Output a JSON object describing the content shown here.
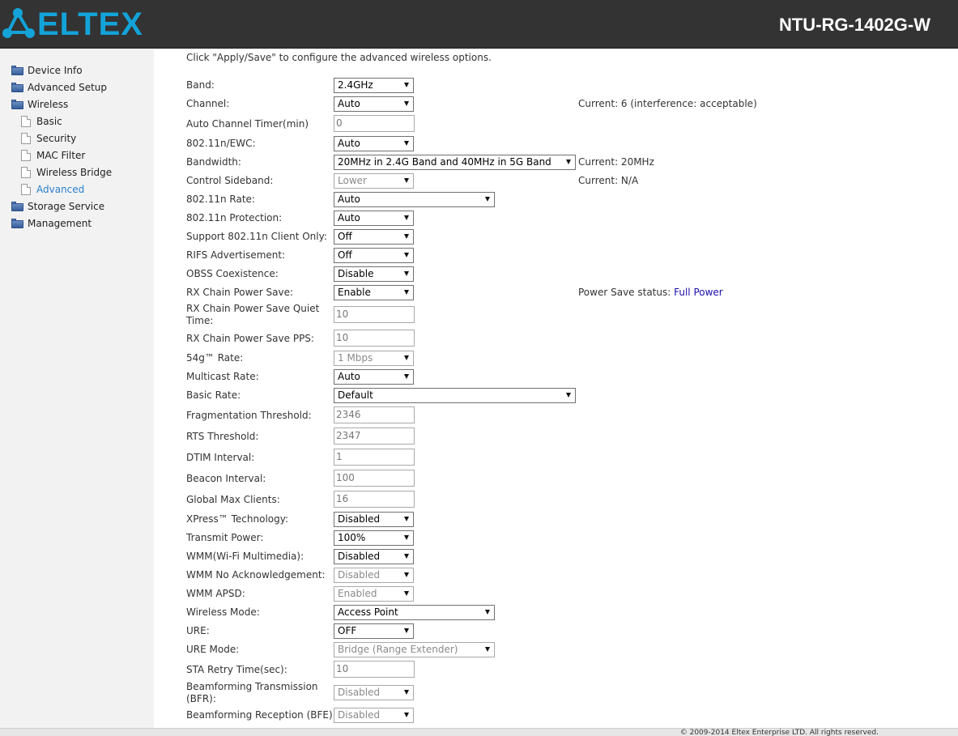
{
  "header": {
    "logo_text": "ELTEX",
    "model": "NTU-RG-1402G-W"
  },
  "sidebar": {
    "items": [
      {
        "label": "Device Info",
        "type": "folder"
      },
      {
        "label": "Advanced Setup",
        "type": "folder"
      },
      {
        "label": "Wireless",
        "type": "folder"
      },
      {
        "label": "Basic",
        "type": "doc"
      },
      {
        "label": "Security",
        "type": "doc"
      },
      {
        "label": "MAC Filter",
        "type": "doc"
      },
      {
        "label": "Wireless Bridge",
        "type": "doc"
      },
      {
        "label": "Advanced",
        "type": "doc",
        "active": true
      },
      {
        "label": "Storage Service",
        "type": "folder"
      },
      {
        "label": "Management",
        "type": "folder"
      }
    ]
  },
  "main": {
    "intro": "Click \"Apply/Save\" to configure the advanced wireless options.",
    "fields": {
      "band": {
        "label": "Band:",
        "value": "2.4GHz"
      },
      "channel": {
        "label": "Channel:",
        "value": "Auto",
        "status": "Current: 6 (interference: acceptable)"
      },
      "auto_channel_timer": {
        "label": "Auto Channel Timer(min)",
        "value": "0"
      },
      "ewc": {
        "label": "802.11n/EWC:",
        "value": "Auto"
      },
      "bandwidth": {
        "label": "Bandwidth:",
        "value": "20MHz in 2.4G Band and 40MHz in 5G Band",
        "status": "Current: 20MHz"
      },
      "control_sideband": {
        "label": "Control Sideband:",
        "value": "Lower",
        "status": "Current: N/A"
      },
      "n_rate": {
        "label": "802.11n Rate:",
        "value": "Auto"
      },
      "n_protection": {
        "label": "802.11n Protection:",
        "value": "Auto"
      },
      "n_client_only": {
        "label": "Support 802.11n Client Only:",
        "value": "Off"
      },
      "rifs": {
        "label": "RIFS Advertisement:",
        "value": "Off"
      },
      "obss": {
        "label": "OBSS Coexistence:",
        "value": "Disable"
      },
      "rx_power_save": {
        "label": "RX Chain Power Save:",
        "value": "Enable",
        "status_prefix": "Power Save status: ",
        "status_value": "Full Power"
      },
      "rx_quiet_time": {
        "label": "RX Chain Power Save Quiet Time:",
        "value": "10"
      },
      "rx_pps": {
        "label": "RX Chain Power Save PPS:",
        "value": "10"
      },
      "g_rate": {
        "label": "54g™ Rate:",
        "value": "1 Mbps"
      },
      "multicast_rate": {
        "label": "Multicast Rate:",
        "value": "Auto"
      },
      "basic_rate": {
        "label": "Basic Rate:",
        "value": "Default"
      },
      "frag_threshold": {
        "label": "Fragmentation Threshold:",
        "value": "2346"
      },
      "rts_threshold": {
        "label": "RTS Threshold:",
        "value": "2347"
      },
      "dtim": {
        "label": "DTIM Interval:",
        "value": "1"
      },
      "beacon": {
        "label": "Beacon Interval:",
        "value": "100"
      },
      "max_clients": {
        "label": "Global Max Clients:",
        "value": "16"
      },
      "xpress": {
        "label": "XPress™ Technology:",
        "value": "Disabled"
      },
      "tx_power": {
        "label": "Transmit Power:",
        "value": "100%"
      },
      "wmm": {
        "label": "WMM(Wi-Fi Multimedia):",
        "value": "Disabled"
      },
      "wmm_noack": {
        "label": "WMM No Acknowledgement:",
        "value": "Disabled"
      },
      "wmm_apsd": {
        "label": "WMM APSD:",
        "value": "Enabled"
      },
      "wireless_mode": {
        "label": "Wireless Mode:",
        "value": "Access Point"
      },
      "ure": {
        "label": "URE:",
        "value": "OFF"
      },
      "ure_mode": {
        "label": "URE Mode:",
        "value": "Bridge (Range Extender)"
      },
      "sta_retry": {
        "label": "STA Retry Time(sec):",
        "value": "10"
      },
      "bfr": {
        "label": "Beamforming Transmission (BFR):",
        "value": "Disabled"
      },
      "bfe": {
        "label": "Beamforming Reception (BFE):",
        "value": "Disabled"
      }
    }
  },
  "footer": {
    "copyright": "© 2009-2014 Eltex Enterprise LTD. All rights reserved."
  }
}
